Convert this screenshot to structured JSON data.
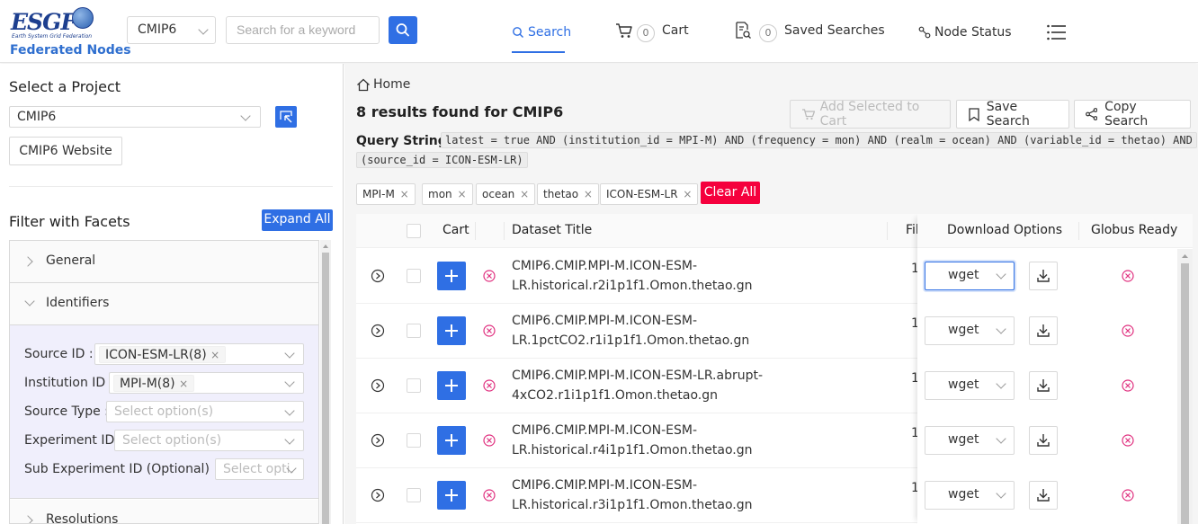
{
  "header": {
    "logo_text": "ESGF",
    "logo_subtitle": "Earth System Grid Federation",
    "logo_caption": "Federated Nodes",
    "project_select": "CMIP6",
    "search_placeholder": "Search for a keyword",
    "nav": {
      "search": "Search",
      "cart_count": "0",
      "cart": "Cart",
      "saved_count": "0",
      "saved": "Saved Searches",
      "node_status": "Node Status"
    }
  },
  "sidebar": {
    "select_project_title": "Select a Project",
    "project_value": "CMIP6",
    "website_button": "CMIP6 Website",
    "filter_title": "Filter with Facets",
    "expand_all": "Expand All",
    "facets": {
      "general": "General",
      "identifiers": "Identifiers",
      "resolutions": "Resolutions"
    },
    "fields": {
      "source_id_label": "Source ID",
      "source_id_tag": "ICON-ESM-LR(8)",
      "institution_id_label": "Institution ID",
      "institution_id_tag": "MPI-M(8)",
      "source_type_label": "Source Type",
      "source_type_placeholder": "Select option(s)",
      "experiment_id_label": "Experiment ID",
      "experiment_id_placeholder": "Select option(s)",
      "sub_experiment_label": "Sub Experiment ID (Optional)",
      "sub_experiment_placeholder": "Select opti..."
    }
  },
  "main": {
    "breadcrumb": "Home",
    "results_title": "8 results found for CMIP6",
    "add_to_cart": "Add Selected to Cart",
    "save_search": "Save Search",
    "copy_search": "Copy Search",
    "query_label": "Query String:",
    "query_line1": "latest = true AND (institution_id = MPI-M) AND (frequency = mon) AND (realm = ocean) AND (variable_id = thetao) AND",
    "query_line2": "(source_id = ICON-ESM-LR)",
    "chips": [
      "MPI-M",
      "mon",
      "ocean",
      "thetao",
      "ICON-ESM-LR"
    ],
    "chip_close": "×",
    "clear_all": "Clear All",
    "table": {
      "headers": {
        "cart": "Cart",
        "title": "Dataset Title",
        "files": "Fil",
        "download": "Download Options",
        "globus": "Globus Ready"
      },
      "rows": [
        {
          "title_l1": "CMIP6.CMIP.MPI-M.ICON-ESM-",
          "title_l2": "LR.historical.r2i1p1f1.Omon.thetao.gn",
          "files": "1",
          "download": "wget"
        },
        {
          "title_l1": "CMIP6.CMIP.MPI-M.ICON-ESM-",
          "title_l2": "LR.1pctCO2.r1i1p1f1.Omon.thetao.gn",
          "files": "1",
          "download": "wget"
        },
        {
          "title_l1": "CMIP6.CMIP.MPI-M.ICON-ESM-LR.abrupt-",
          "title_l2": "4xCO2.r1i1p1f1.Omon.thetao.gn",
          "files": "1",
          "download": "wget"
        },
        {
          "title_l1": "CMIP6.CMIP.MPI-M.ICON-ESM-",
          "title_l2": "LR.historical.r4i1p1f1.Omon.thetao.gn",
          "files": "1",
          "download": "wget"
        },
        {
          "title_l1": "CMIP6.CMIP.MPI-M.ICON-ESM-",
          "title_l2": "LR.historical.r3i1p1f1.Omon.thetao.gn",
          "files": "1",
          "download": "wget"
        }
      ]
    }
  },
  "colors": {
    "primary": "#2f6fe4",
    "danger": "#f5003d",
    "globus_x": "#e0307f",
    "facet_bg": "#f0effc"
  }
}
